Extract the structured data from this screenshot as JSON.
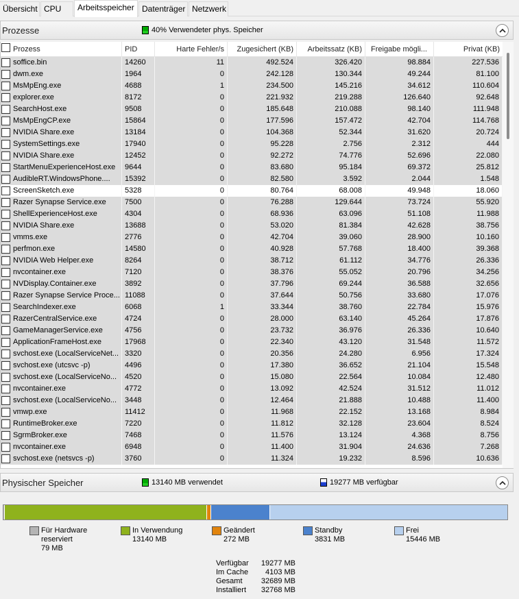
{
  "tabs": [
    "Übersicht",
    "CPU",
    "Arbeitsspeicher",
    "Datenträger",
    "Netzwerk"
  ],
  "processes_section": {
    "title": "Prozesse",
    "info": "40% Verwendeter phys. Speicher"
  },
  "columns": [
    "Prozess",
    "PID",
    "Harte Fehler/s",
    "Zugesichert (KB)",
    "Arbeitssatz (KB)",
    "Freigabe mögli...",
    "Privat (KB)"
  ],
  "processes": [
    [
      "soffice.bin",
      "14260",
      "11",
      "492.524",
      "326.420",
      "98.884",
      "227.536"
    ],
    [
      "dwm.exe",
      "1964",
      "0",
      "242.128",
      "130.344",
      "49.244",
      "81.100"
    ],
    [
      "MsMpEng.exe",
      "4688",
      "1",
      "234.500",
      "145.216",
      "34.612",
      "110.604"
    ],
    [
      "explorer.exe",
      "8172",
      "0",
      "221.932",
      "219.288",
      "126.640",
      "92.648"
    ],
    [
      "SearchHost.exe",
      "9508",
      "0",
      "185.648",
      "210.088",
      "98.140",
      "111.948"
    ],
    [
      "MsMpEngCP.exe",
      "15864",
      "0",
      "177.596",
      "157.472",
      "42.704",
      "114.768"
    ],
    [
      "NVIDIA Share.exe",
      "13184",
      "0",
      "104.368",
      "52.344",
      "31.620",
      "20.724"
    ],
    [
      "SystemSettings.exe",
      "17940",
      "0",
      "95.228",
      "2.756",
      "2.312",
      "444"
    ],
    [
      "NVIDIA Share.exe",
      "12452",
      "0",
      "92.272",
      "74.776",
      "52.696",
      "22.080"
    ],
    [
      "StartMenuExperienceHost.exe",
      "9644",
      "0",
      "83.680",
      "95.184",
      "69.372",
      "25.812"
    ],
    [
      "AudibleRT.WindowsPhone....",
      "15392",
      "0",
      "82.580",
      "3.592",
      "2.044",
      "1.548"
    ],
    [
      "ScreenSketch.exe",
      "5328",
      "0",
      "80.764",
      "68.008",
      "49.948",
      "18.060"
    ],
    [
      "Razer Synapse Service.exe",
      "7500",
      "0",
      "76.288",
      "129.644",
      "73.724",
      "55.920"
    ],
    [
      "ShellExperienceHost.exe",
      "4304",
      "0",
      "68.936",
      "63.096",
      "51.108",
      "11.988"
    ],
    [
      "NVIDIA Share.exe",
      "13688",
      "0",
      "53.020",
      "81.384",
      "42.628",
      "38.756"
    ],
    [
      "vmms.exe",
      "2776",
      "0",
      "42.704",
      "39.060",
      "28.900",
      "10.160"
    ],
    [
      "perfmon.exe",
      "14580",
      "0",
      "40.928",
      "57.768",
      "18.400",
      "39.368"
    ],
    [
      "NVIDIA Web Helper.exe",
      "8264",
      "0",
      "38.712",
      "61.112",
      "34.776",
      "26.336"
    ],
    [
      "nvcontainer.exe",
      "7120",
      "0",
      "38.376",
      "55.052",
      "20.796",
      "34.256"
    ],
    [
      "NVDisplay.Container.exe",
      "3892",
      "0",
      "37.796",
      "69.244",
      "36.588",
      "32.656"
    ],
    [
      "Razer Synapse Service Proce...",
      "11088",
      "0",
      "37.644",
      "50.756",
      "33.680",
      "17.076"
    ],
    [
      "SearchIndexer.exe",
      "6068",
      "1",
      "33.344",
      "38.760",
      "22.784",
      "15.976"
    ],
    [
      "RazerCentralService.exe",
      "4724",
      "0",
      "28.000",
      "63.140",
      "45.264",
      "17.876"
    ],
    [
      "GameManagerService.exe",
      "4756",
      "0",
      "23.732",
      "36.976",
      "26.336",
      "10.640"
    ],
    [
      "ApplicationFrameHost.exe",
      "17968",
      "0",
      "22.340",
      "43.120",
      "31.548",
      "11.572"
    ],
    [
      "svchost.exe (LocalServiceNet...",
      "3320",
      "0",
      "20.356",
      "24.280",
      "6.956",
      "17.324"
    ],
    [
      "svchost.exe (utcsvc -p)",
      "4496",
      "0",
      "17.380",
      "36.652",
      "21.104",
      "15.548"
    ],
    [
      "svchost.exe (LocalServiceNo...",
      "4520",
      "0",
      "15.080",
      "22.564",
      "10.084",
      "12.480"
    ],
    [
      "nvcontainer.exe",
      "4772",
      "0",
      "13.092",
      "42.524",
      "31.512",
      "11.012"
    ],
    [
      "svchost.exe (LocalServiceNo...",
      "3448",
      "0",
      "12.464",
      "21.888",
      "10.488",
      "11.400"
    ],
    [
      "vmwp.exe",
      "11412",
      "0",
      "11.968",
      "22.152",
      "13.168",
      "8.984"
    ],
    [
      "RuntimeBroker.exe",
      "7220",
      "0",
      "11.812",
      "32.128",
      "23.604",
      "8.524"
    ],
    [
      "SgrmBroker.exe",
      "7468",
      "0",
      "11.576",
      "13.124",
      "4.368",
      "8.756"
    ],
    [
      "nvcontainer.exe",
      "6948",
      "0",
      "11.400",
      "31.904",
      "24.636",
      "7.268"
    ],
    [
      "svchost.exe (netsvcs -p)",
      "3760",
      "0",
      "11.324",
      "19.232",
      "8.596",
      "10.636"
    ]
  ],
  "highlight_row": 11,
  "physical_section": {
    "title": "Physischer Speicher",
    "used": "13140 MB verwendet",
    "available": "19277 MB verfügbar"
  },
  "memory_segments": [
    {
      "label": "Für Hardware reserviert",
      "label_lines": [
        "Für Hardware",
        "reserviert"
      ],
      "value": "79 MB",
      "mb": 79,
      "color": "#b4b4b4"
    },
    {
      "label": "In Verwendung",
      "label_lines": [
        "In Verwendung"
      ],
      "value": "13140 MB",
      "mb": 13140,
      "color": "#8fb21d"
    },
    {
      "label": "Geändert",
      "label_lines": [
        "Geändert"
      ],
      "value": "272 MB",
      "mb": 272,
      "color": "#e1840d"
    },
    {
      "label": "Standby",
      "label_lines": [
        "Standby"
      ],
      "value": "3831 MB",
      "mb": 3831,
      "color": "#4b82cd"
    },
    {
      "label": "Frei",
      "label_lines": [
        "Frei"
      ],
      "value": "15446 MB",
      "mb": 15446,
      "color": "#b7d0ee"
    }
  ],
  "stats": [
    [
      "Verfügbar",
      "19277 MB"
    ],
    [
      "Im Cache",
      "4103 MB"
    ],
    [
      "Gesamt",
      "32689 MB"
    ],
    [
      "Installiert",
      "32768 MB"
    ]
  ]
}
